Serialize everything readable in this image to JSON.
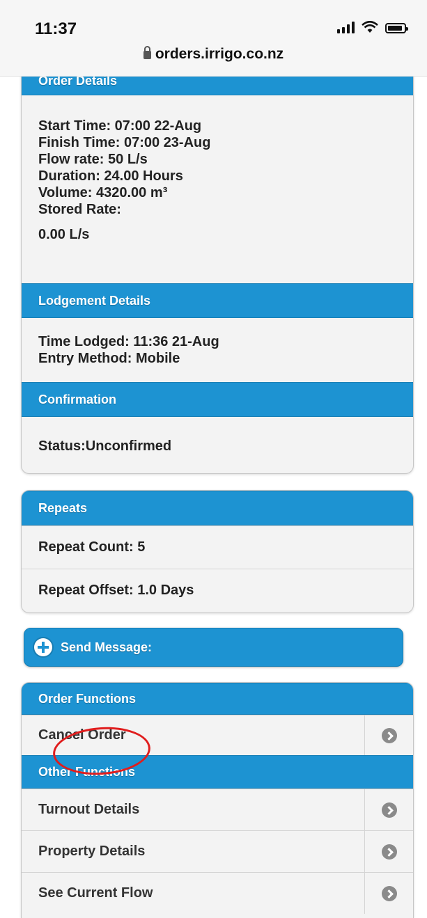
{
  "status_bar": {
    "time": "11:37",
    "url": "orders.irrigo.co.nz"
  },
  "order_details": {
    "header": "Order Details",
    "lines": [
      "Start Time: 07:00 22-Aug",
      "Finish Time: 07:00 23-Aug",
      "Flow rate: 50 L/s",
      "Duration: 24.00 Hours",
      "Volume: 4320.00 m³",
      "Stored Rate:"
    ],
    "stored_rate_value": "0.00 L/s"
  },
  "lodgement": {
    "header": "Lodgement Details",
    "lines": [
      "Time Lodged: 11:36 21-Aug",
      "Entry Method: Mobile"
    ]
  },
  "confirmation": {
    "header": "Confirmation",
    "status": "Status:Unconfirmed"
  },
  "repeats": {
    "header": "Repeats",
    "count": "Repeat Count: 5",
    "offset": "Repeat Offset: 1.0 Days"
  },
  "send_message": {
    "label": "Send Message:"
  },
  "order_functions": {
    "header": "Order Functions",
    "items": [
      "Cancel Order"
    ]
  },
  "other_functions": {
    "header": "Other Functions",
    "items": [
      "Turnout Details",
      "Property Details",
      "See Current Flow"
    ]
  },
  "colors": {
    "accent": "#1d93d2",
    "annotation": "#e01d1d"
  }
}
